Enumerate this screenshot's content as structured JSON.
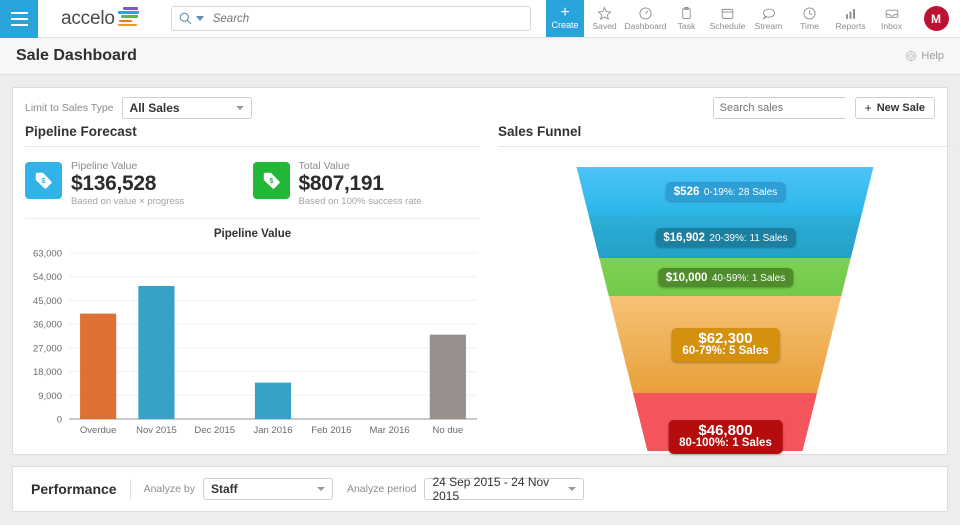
{
  "topbar": {
    "menu_icon": "hamburger-icon",
    "logo_text": "accelo",
    "search_placeholder": "Search",
    "create_label": "Create",
    "create_plus": "+",
    "nav_items": [
      {
        "label": "Saved",
        "icon": "star-icon"
      },
      {
        "label": "Dashboard",
        "icon": "speedometer-icon"
      },
      {
        "label": "Task",
        "icon": "clipboard-icon"
      },
      {
        "label": "Schedule",
        "icon": "calendar-icon"
      },
      {
        "label": "Stream",
        "icon": "chat-icon"
      },
      {
        "label": "Time",
        "icon": "clock-icon"
      },
      {
        "label": "Reports",
        "icon": "bar-chart-icon"
      },
      {
        "label": "Inbox",
        "icon": "inbox-icon"
      }
    ],
    "avatar_initial": "M",
    "avatar_color": "#bb1133",
    "accent_color": "#29a4db"
  },
  "page_header": {
    "title": "Sale Dashboard",
    "help_label": "Help",
    "help_icon": "lifering-icon"
  },
  "filters": {
    "sales_type_label": "Limit to Sales Type",
    "sales_type_value": "All Sales",
    "search_placeholder": "Search sales",
    "search_value": "",
    "search_icon": "magnifier-icon",
    "new_sale_label": "New Sale",
    "new_sale_plus": "+"
  },
  "pipeline": {
    "section_title": "Pipeline Forecast",
    "kpis": [
      {
        "name": "Pipeline Value",
        "value": "$136,528",
        "sub": "Based on value × progress",
        "icon": "price-tag-icon",
        "color": "#2fb3e8"
      },
      {
        "name": "Total Value",
        "value": "$807,191",
        "sub": "Based on 100% success rate",
        "icon": "price-tag-icon",
        "color": "#23b737"
      }
    ]
  },
  "funnel_section": {
    "section_title": "Sales Funnel"
  },
  "performance": {
    "title": "Performance",
    "analyze_by_label": "Analyze by",
    "analyze_by_value": "Staff",
    "analyze_period_label": "Analyze period",
    "analyze_period_value": "24 Sep 2015 - 24 Nov 2015"
  },
  "chart_data": [
    {
      "type": "bar",
      "title": "Pipeline Value",
      "xlabel": "",
      "ylabel": "",
      "categories": [
        "Overdue",
        "Nov 2015",
        "Dec 2015",
        "Jan 2016",
        "Feb 2016",
        "Mar 2016",
        "No due"
      ],
      "values": [
        40000,
        50500,
        0,
        13800,
        0,
        0,
        32000
      ],
      "colors": [
        "#dd7032",
        "#36a2c7",
        "#36a2c7",
        "#36a2c7",
        "#36a2c7",
        "#36a2c7",
        "#968f8c"
      ],
      "ylim": [
        0,
        63000
      ],
      "yticks": [
        0,
        9000,
        18000,
        27000,
        36000,
        45000,
        54000,
        63000
      ],
      "ytick_labels": [
        "0",
        "9,000",
        "18,000",
        "27,000",
        "36,000",
        "45,000",
        "54,000",
        "63,000"
      ],
      "grid": true,
      "legend": "none"
    },
    {
      "type": "funnel",
      "title": "Sales Funnel",
      "stages": [
        {
          "label": "0-19%: 28 Sales",
          "amount": "$526",
          "value": 526,
          "range": "0-19%",
          "sales": 28,
          "color": "#4fc3f7",
          "color2": "#29b6e8",
          "label_bg": "#2e9fd4"
        },
        {
          "label": "20-39%: 11 Sales",
          "amount": "$16,902",
          "value": 16902,
          "range": "20-39%",
          "sales": 11,
          "color": "#2cafd8",
          "color2": "#24a0c8",
          "label_bg": "#1c7fa0"
        },
        {
          "label": "40-59%: 1 Sales",
          "amount": "$10,000",
          "value": 10000,
          "range": "40-59%",
          "sales": 1,
          "color": "#7ed152",
          "color2": "#72c94a",
          "label_bg": "#4e8c2c"
        },
        {
          "label": "60-79%: 5 Sales",
          "amount": "$62,300",
          "value": 62300,
          "range": "60-79%",
          "sales": 5,
          "color": "#f7c276",
          "color2": "#e8a03a",
          "label_bg": "#d4900f"
        },
        {
          "label": "80-100%: 1 Sales",
          "amount": "$46,800",
          "value": 46800,
          "range": "80-100%",
          "sales": 1,
          "color": "#f4545c",
          "color2": "#f4545c",
          "label_bg": "#b50d0d"
        }
      ]
    }
  ]
}
